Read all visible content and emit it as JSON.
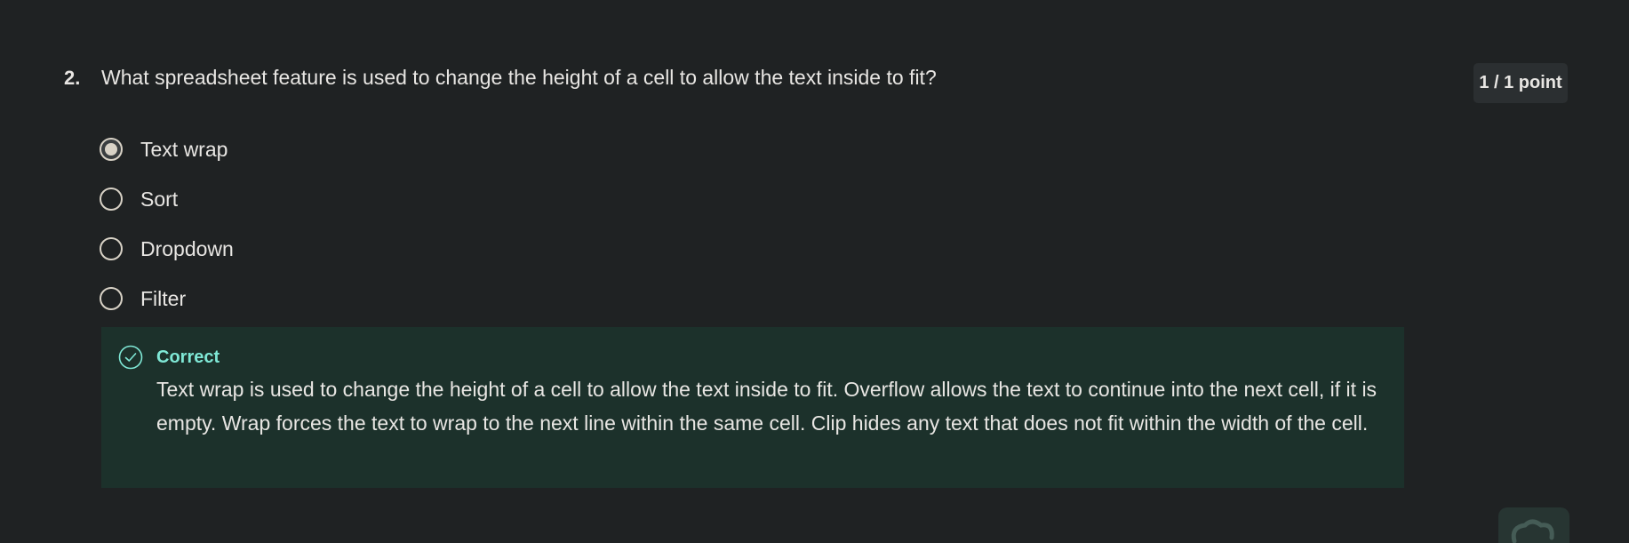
{
  "question": {
    "number": "2.",
    "text": "What spreadsheet feature is used to change the height of a cell to allow the text inside to fit?",
    "points": "1 / 1 point"
  },
  "options": [
    {
      "label": "Text wrap",
      "selected": true
    },
    {
      "label": "Sort",
      "selected": false
    },
    {
      "label": "Dropdown",
      "selected": false
    },
    {
      "label": "Filter",
      "selected": false
    }
  ],
  "feedback": {
    "status": "Correct",
    "icon": "check-circle-icon",
    "explanation": "Text wrap is used to change the height of a cell to allow the text inside to fit. Overflow allows the text to continue into the next cell, if it is empty. Wrap forces the text to wrap to the next line within the same cell. Clip hides any text that does not fit within the width of the cell."
  },
  "colors": {
    "background": "#1f2223",
    "feedback_background": "#1c312b",
    "correct_accent": "#7fe8d6",
    "badge_background": "#2b2f31"
  }
}
